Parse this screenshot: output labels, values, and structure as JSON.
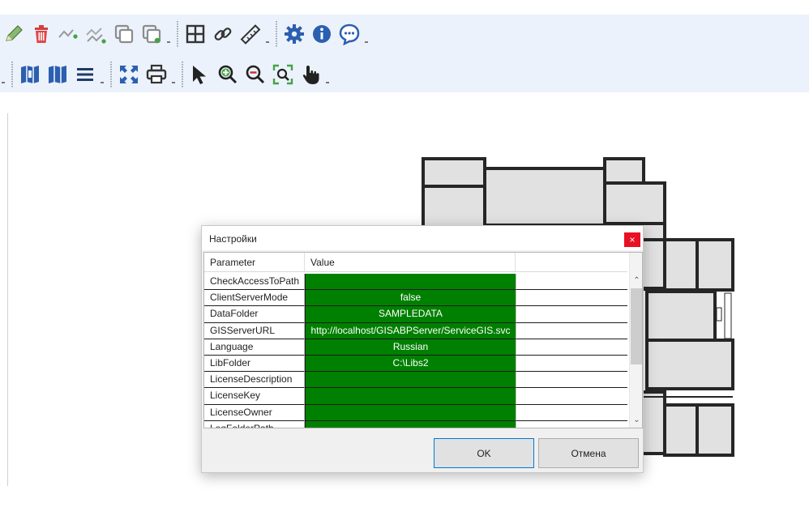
{
  "toolbar": {
    "row1": [
      "pencil-icon",
      "trash-icon",
      "polyline-icon",
      "polyline-edit-icon",
      "copy-icon",
      "copy-check-icon",
      "grid-icon",
      "link-icon",
      "ruler-icon",
      "gear-icon",
      "info-icon",
      "chat-icon"
    ],
    "row2": [
      "layers-map-icon",
      "map-icon",
      "list-icon",
      "fullscreen-icon",
      "print-icon",
      "pointer-icon",
      "zoom-in-icon",
      "zoom-out-icon",
      "zoom-fit-icon",
      "pan-hand-icon"
    ]
  },
  "colors": {
    "accent": "#2b5fb0",
    "value_cell": "#008000",
    "close": "#e81123",
    "toolbar_bg": "#ecf2fb"
  },
  "dialog": {
    "title": "Настройки",
    "close_label": "×",
    "columns": [
      "Parameter",
      "Value"
    ],
    "rows": [
      {
        "param": "CheckAccessToPath",
        "value": ""
      },
      {
        "param": "ClientServerMode",
        "value": "false"
      },
      {
        "param": "DataFolder",
        "value": "SAMPLEDATA"
      },
      {
        "param": "GISServerURL",
        "value": "http://localhost/GISABPServer/ServiceGIS.svc"
      },
      {
        "param": "Language",
        "value": "Russian"
      },
      {
        "param": "LibFolder",
        "value": "C:\\Libs2"
      },
      {
        "param": "LicenseDescription",
        "value": ""
      },
      {
        "param": "LicenseKey",
        "value": ""
      },
      {
        "param": "LicenseOwner",
        "value": ""
      },
      {
        "param": "LogFolderPath",
        "value": ""
      }
    ],
    "ok_label": "OK",
    "cancel_label": "Отмена"
  }
}
